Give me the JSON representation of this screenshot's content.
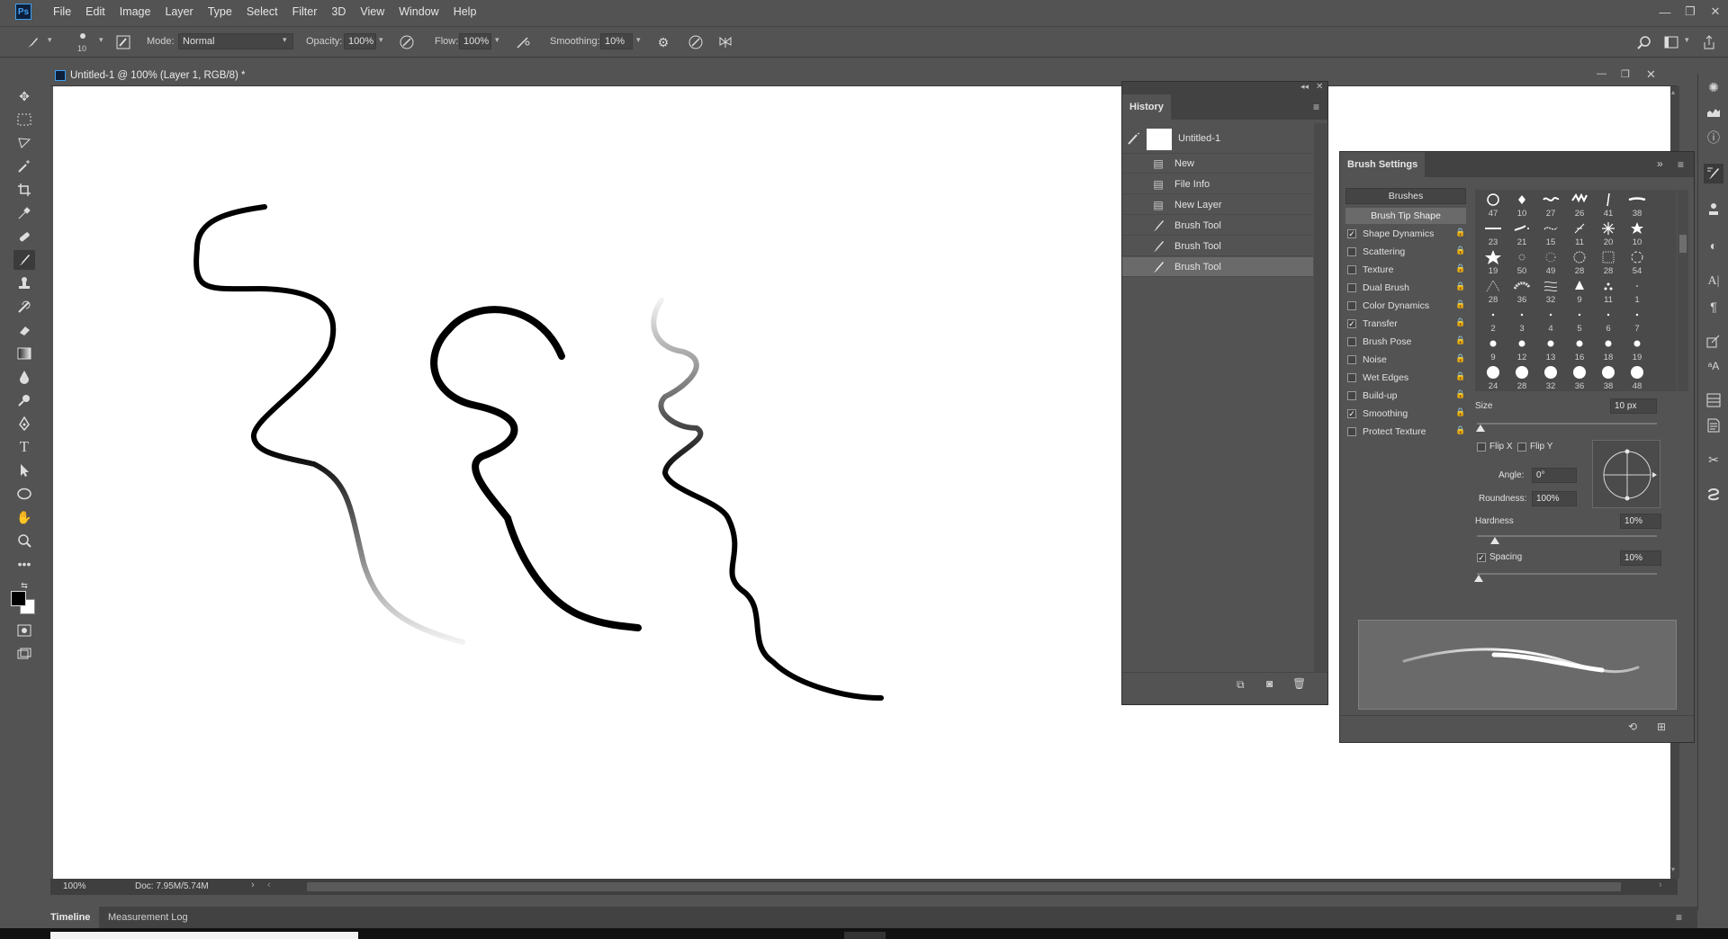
{
  "app": {
    "logo": "Ps",
    "menu": [
      "File",
      "Edit",
      "Image",
      "Layer",
      "Type",
      "Select",
      "Filter",
      "3D",
      "View",
      "Window",
      "Help"
    ],
    "window_controls": [
      "—",
      "❐",
      "✕"
    ]
  },
  "options": {
    "brush_size": "10",
    "mode_label": "Mode:",
    "mode_value": "Normal",
    "opacity_label": "Opacity:",
    "opacity_value": "100%",
    "flow_label": "Flow:",
    "flow_value": "100%",
    "smoothing_label": "Smoothing:",
    "smoothing_value": "10%"
  },
  "document": {
    "title": "Untitled-1 @ 100% (Layer 1, RGB/8) *",
    "zoom": "100%",
    "doc_info": "Doc: 7.95M/5.74M"
  },
  "history": {
    "tab": "History",
    "snapshot": "Untitled-1",
    "items": [
      "New",
      "File Info",
      "New Layer",
      "Brush Tool",
      "Brush Tool",
      "Brush Tool"
    ],
    "selected_index": 5
  },
  "brush_settings": {
    "tab": "Brush Settings",
    "brushes_button": "Brushes",
    "tip_shape": "Brush Tip Shape",
    "options": [
      {
        "label": "Shape Dynamics",
        "checked": true
      },
      {
        "label": "Scattering",
        "checked": false
      },
      {
        "label": "Texture",
        "checked": false
      },
      {
        "label": "Dual Brush",
        "checked": false
      },
      {
        "label": "Color Dynamics",
        "checked": false
      },
      {
        "label": "Transfer",
        "checked": true
      },
      {
        "label": "Brush Pose",
        "checked": false
      },
      {
        "label": "Noise",
        "checked": false
      },
      {
        "label": "Wet Edges",
        "checked": false
      },
      {
        "label": "Build-up",
        "checked": false
      },
      {
        "label": "Smoothing",
        "checked": true
      },
      {
        "label": "Protect Texture",
        "checked": false
      }
    ],
    "tip_sizes": [
      [
        "47",
        "10",
        "27",
        "26",
        "41",
        "38"
      ],
      [
        "23",
        "21",
        "15",
        "11",
        "20",
        "10"
      ],
      [
        "19",
        "50",
        "49",
        "28",
        "28",
        "54"
      ],
      [
        "28",
        "36",
        "32",
        "9",
        "11",
        "1"
      ],
      [
        "2",
        "3",
        "4",
        "5",
        "6",
        "7"
      ],
      [
        "9",
        "12",
        "13",
        "16",
        "18",
        "19"
      ],
      [
        "24",
        "28",
        "32",
        "36",
        "38",
        "48"
      ]
    ],
    "size_label": "Size",
    "size_value": "10 px",
    "size_level": 0.02,
    "flip_x": "Flip X",
    "flip_y": "Flip Y",
    "angle_label": "Angle:",
    "angle_value": "0°",
    "roundness_label": "Roundness:",
    "roundness_value": "100%",
    "hardness_label": "Hardness",
    "hardness_value": "10%",
    "hardness_level": 0.1,
    "spacing_label": "Spacing",
    "spacing_value": "10%",
    "spacing_checked": true,
    "spacing_level": 0.01
  },
  "bottom": {
    "tabs": [
      "Timeline",
      "Measurement Log"
    ]
  }
}
